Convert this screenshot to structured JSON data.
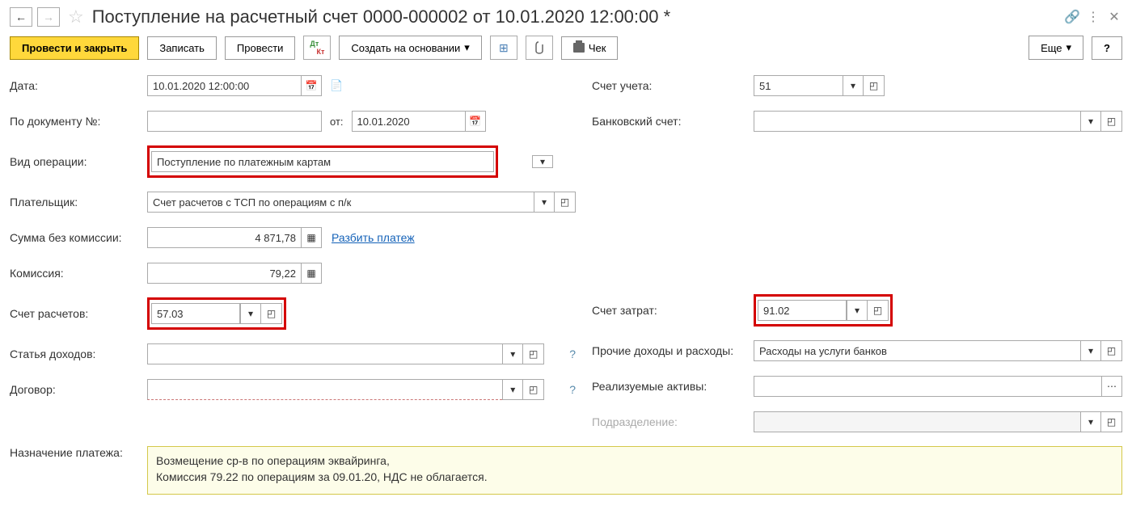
{
  "title": "Поступление на расчетный счет 0000-000002 от 10.01.2020 12:00:00 *",
  "toolbar": {
    "post_close": "Провести и закрыть",
    "save": "Записать",
    "post": "Провести",
    "create_based": "Создать на основании",
    "check": "Чек",
    "more": "Еще"
  },
  "labels": {
    "date": "Дата:",
    "by_doc": "По документу №:",
    "from": "от:",
    "op_type": "Вид операции:",
    "payer": "Плательщик:",
    "sum_no_fee": "Сумма без комиссии:",
    "fee": "Комиссия:",
    "calc_acc": "Счет расчетов:",
    "income_item": "Статья доходов:",
    "contract": "Договор:",
    "purpose": "Назначение платежа:",
    "ledger_acc": "Счет учета:",
    "bank_acc": "Банковский счет:",
    "cost_acc": "Счет затрат:",
    "other_ie": "Прочие доходы и расходы:",
    "assets": "Реализуемые активы:",
    "division": "Подразделение:",
    "split": "Разбить платеж"
  },
  "values": {
    "date": "10.01.2020 12:00:00",
    "by_doc_no": "",
    "by_doc_date": "10.01.2020",
    "op_type": "Поступление по платежным картам",
    "payer": "Счет расчетов с ТСП по операциям с п/к",
    "sum_no_fee": "4 871,78",
    "fee": "79,22",
    "calc_acc": "57.03",
    "income_item": "",
    "contract": "",
    "ledger_acc": "51",
    "bank_acc": "",
    "cost_acc": "91.02",
    "other_ie": "Расходы на услуги банков",
    "assets": "",
    "division": "",
    "purpose_l1": "Возмещение ср-в по операциям эквайринга,",
    "purpose_l2": "Комиссия 79.22 по операциям за 09.01.20, НДС не облагается."
  }
}
